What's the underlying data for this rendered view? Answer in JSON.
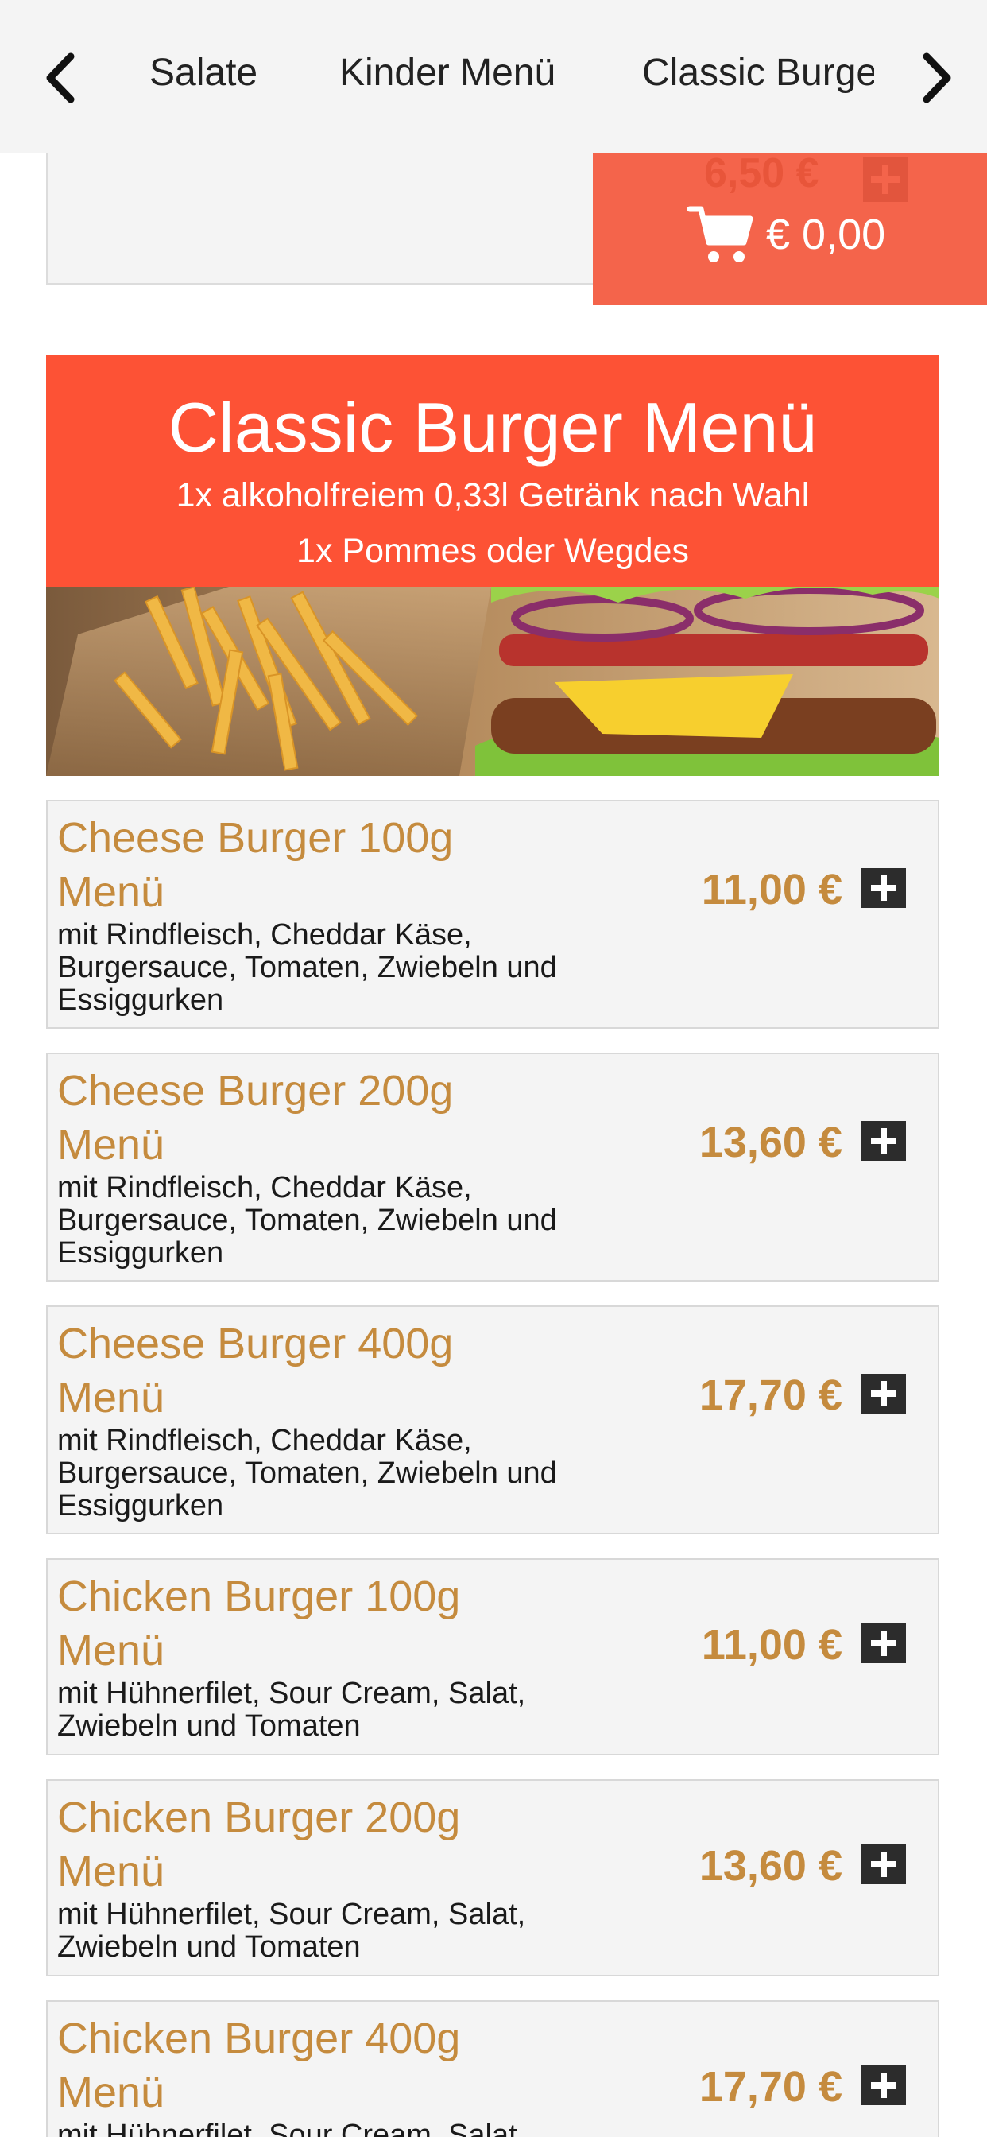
{
  "nav": {
    "tabs": [
      {
        "label": "Salate"
      },
      {
        "label": "Kinder Menü"
      },
      {
        "label": "Classic Burger Menü"
      }
    ]
  },
  "prev_item": {
    "price": "6,50 €"
  },
  "cart": {
    "total": "€ 0,00",
    "icon": "shopping-cart-icon"
  },
  "section": {
    "title": "Classic Burger Menü",
    "subtitle_line1": "1x alkoholfreiem 0,33l Getränk nach Wahl",
    "subtitle_line2": "1x Pommes oder Wegdes"
  },
  "items": [
    {
      "name": "Cheese Burger 100g Menü",
      "desc": "mit Rindfleisch, Cheddar Käse, Burgersauce, Tomaten, Zwiebeln und Essiggurken",
      "price": "11,00 €"
    },
    {
      "name": "Cheese Burger 200g Menü",
      "desc": "mit Rindfleisch, Cheddar Käse, Burgersauce, Tomaten, Zwiebeln und Essiggurken",
      "price": "13,60 €"
    },
    {
      "name": "Cheese Burger 400g Menü",
      "desc": "mit Rindfleisch, Cheddar Käse, Burgersauce, Tomaten, Zwiebeln und Essiggurken",
      "price": "17,70 €"
    },
    {
      "name": "Chicken Burger 100g Menü",
      "desc": "mit Hühnerfilet, Sour Cream, Salat, Zwiebeln und Tomaten",
      "price": "11,00 €"
    },
    {
      "name": "Chicken Burger 200g Menü",
      "desc": "mit Hühnerfilet, Sour Cream, Salat, Zwiebeln und Tomaten",
      "price": "13,60 €"
    },
    {
      "name": "Chicken Burger 400g Menü",
      "desc": "mit Hühnerfilet, Sour Cream, Salat, Zwiebeln und Tomaten",
      "price": "17,70 €"
    }
  ],
  "colors": {
    "accent": "#fd5235",
    "price": "#c58b3e",
    "card_bg": "#f4f4f4"
  }
}
